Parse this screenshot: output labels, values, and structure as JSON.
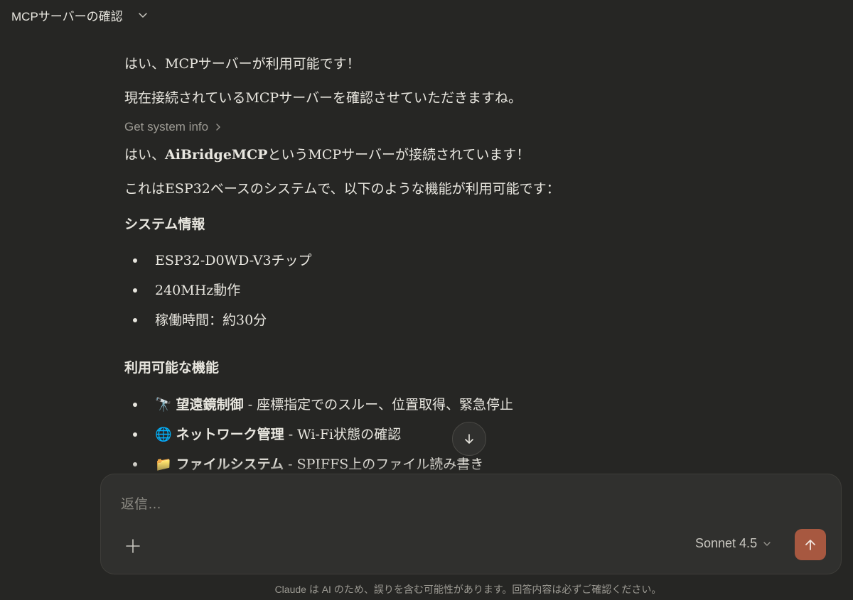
{
  "header": {
    "title": "MCPサーバーの確認",
    "dropdown_icon": "chevron-down-icon"
  },
  "message": {
    "p1": "はい、MCPサーバーが利用可能です！",
    "p2": "現在接続されているMCPサーバーを確認させていただきますね。",
    "tool_call": "Get system info",
    "p3_prefix": "はい、",
    "p3_bold": "AiBridgeMCP",
    "p3_suffix": "というMCPサーバーが接続されています！",
    "p4": "これはESP32ベースのシステムで、以下のような機能が利用可能です：",
    "system_heading": "システム情報",
    "system_items": [
      "ESP32-D0WD-V3チップ",
      "240MHz動作",
      "稼働時間：約30分"
    ],
    "features_heading": "利用可能な機能",
    "features": [
      {
        "emoji": "🔭",
        "name": "望遠鏡制御",
        "desc": " - 座標指定でのスルー、位置取得、緊急停止"
      },
      {
        "emoji": "🌐",
        "name": "ネットワーク管理",
        "desc": " - Wi-Fi状態の確認"
      },
      {
        "emoji": "📁",
        "name": "ファイルシステム",
        "desc": " - SPIFFS上のファイル読み書き"
      }
    ]
  },
  "composer": {
    "placeholder": "返信…",
    "model": "Sonnet 4.5"
  },
  "footer": "Claude は AI のため、誤りを含む可能性があります。回答内容は必ずご確認ください。",
  "colors": {
    "background": "#262624",
    "composer": "#30302e",
    "send_button": "#a75840",
    "text": "#e8e6df",
    "muted": "#9c9a93"
  }
}
